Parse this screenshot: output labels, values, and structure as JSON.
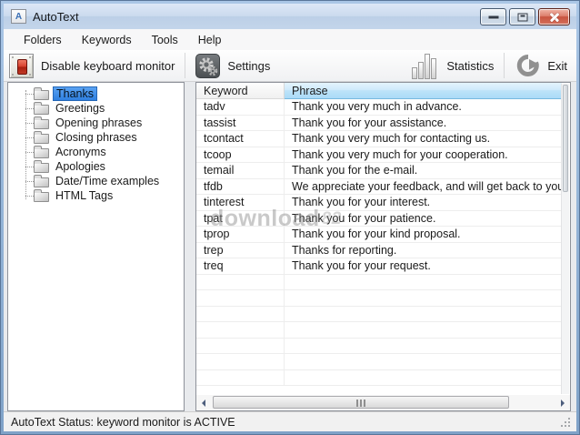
{
  "window": {
    "title": "AutoText",
    "icon_letter": "A"
  },
  "menu": {
    "items": [
      "Folders",
      "Keywords",
      "Tools",
      "Help"
    ]
  },
  "toolbar": {
    "monitor_label": "Disable keyboard monitor",
    "settings_label": "Settings",
    "statistics_label": "Statistics",
    "exit_label": "Exit"
  },
  "tree": {
    "items": [
      {
        "label": "Thanks",
        "selected": true
      },
      {
        "label": "Greetings",
        "selected": false
      },
      {
        "label": "Opening phrases",
        "selected": false
      },
      {
        "label": "Closing phrases",
        "selected": false
      },
      {
        "label": "Acronyms",
        "selected": false
      },
      {
        "label": "Apologies",
        "selected": false
      },
      {
        "label": "Date/Time examples",
        "selected": false
      },
      {
        "label": "HTML Tags",
        "selected": false
      }
    ]
  },
  "table": {
    "columns": [
      "Keyword",
      "Phrase"
    ],
    "rows": [
      {
        "keyword": "tadv",
        "phrase": "Thank you very much in advance."
      },
      {
        "keyword": "tassist",
        "phrase": "Thank you for your assistance."
      },
      {
        "keyword": "tcontact",
        "phrase": "Thank you very much for contacting us."
      },
      {
        "keyword": "tcoop",
        "phrase": "Thank you very much for your cooperation."
      },
      {
        "keyword": "temail",
        "phrase": "Thank you for the e-mail."
      },
      {
        "keyword": "tfdb",
        "phrase": "We appreciate your feedback, and will get back to you as soon a"
      },
      {
        "keyword": "tinterest",
        "phrase": "Thank you for your interest."
      },
      {
        "keyword": "tpat",
        "phrase": "Thank you for your patience."
      },
      {
        "keyword": "tprop",
        "phrase": "Thank you for your kind proposal."
      },
      {
        "keyword": "trep",
        "phrase": "Thanks for reporting."
      },
      {
        "keyword": "treq",
        "phrase": "Thank you for your request."
      }
    ],
    "empty_rows": 7
  },
  "status_bar": {
    "text": "AutoText Status: keyword monitor is ACTIVE"
  },
  "watermark": {
    "text": "download",
    "suffix": "82"
  },
  "colors": {
    "titlebar_blue": "#c6d7eb",
    "frame_blue": "#8fb0d4",
    "close_red": "#c85440",
    "selection_blue": "#2e7fe0",
    "phrase_header_blue": "#abdbf7",
    "toggle_red": "#d6402c"
  }
}
